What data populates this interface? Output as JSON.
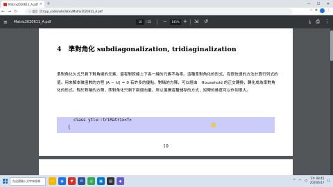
{
  "browser": {
    "tab_title": "Matrix2020611_A.pdf",
    "tab_close": "×",
    "new_tab": "+",
    "omnibox_info": "ⓘ 檔案",
    "url": "D:/cpp_code/note/latex/Matrix2020611_A.pdf"
  },
  "pdf_toolbar": {
    "file_name": "Matrix2020611_A.pdf",
    "current_page": "10",
    "total_pages": "/ 15",
    "zoom": "145%",
    "zoom_out": "−",
    "zoom_in": "+"
  },
  "document": {
    "section_number": "4",
    "section_title": "準對角化 subdiagonalization, tridiaginalization",
    "paragraph": "準對角化久式只剩下對角線的元素，還有對較線上下各一線的元素不為零。這種準對角化的形式，有很快速的方法計算行列式的值。用來解本徵函數的方程 |A − λI| = 0 有許多的優點。對稱的方陣，可以經由　Household 的正交轉換，轉化成為準對角化的形式。對於對稱的方陣，準對角化只剩下兩個向量，所以選擇這種儲存的方式，矩陣的維度可以作到很大。",
    "code_line_1": "class ytlu::triMatrix<T>",
    "code_line_2": "{",
    "page_number": "10"
  },
  "taskbar": {
    "search_placeholder": "在這裡輸入文字來搜尋",
    "time": "下午 08:45",
    "date": "2020/6/17",
    "apps": [
      {
        "name": "file-explorer",
        "color": "#f5b700",
        "glyph": "▭"
      },
      {
        "name": "browser",
        "color": "#1a73e8",
        "glyph": "◉"
      },
      {
        "name": "shield",
        "color": "#d93025",
        "glyph": "▼"
      },
      {
        "name": "mail",
        "color": "#2b579a",
        "glyph": "✉"
      },
      {
        "name": "chrome",
        "color": "#34a853",
        "glyph": "◎"
      },
      {
        "name": "store",
        "color": "#0078d4",
        "glyph": "▣"
      },
      {
        "name": "terminal",
        "color": "#333333",
        "glyph": "▤"
      },
      {
        "name": "photos",
        "color": "#6b5bd2",
        "glyph": "◆"
      }
    ]
  }
}
